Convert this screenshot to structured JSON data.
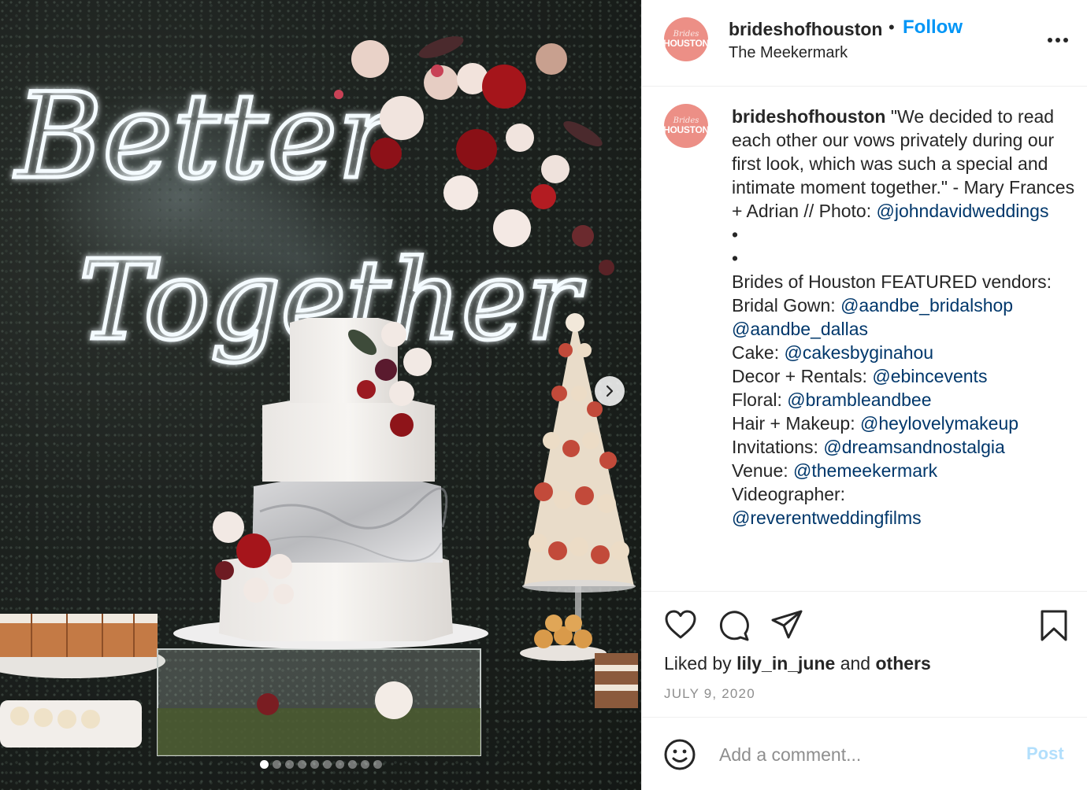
{
  "post": {
    "header": {
      "username": "brideshofhouston",
      "separator": "•",
      "follow_label": "Follow",
      "location": "The Meekermark",
      "more_icon": "more-horizontal-icon"
    },
    "avatar": {
      "script_text": "Brides",
      "word_text": "HOUSTON",
      "color": "#ec8f86"
    },
    "caption": {
      "username": "brideshofhouston",
      "intro": "\"We decided to read each other our vows privately during our first look, which was such a special and intimate moment together.\" - Mary Frances + Adrian // Photo:",
      "photo_credit": "@johndavidweddings",
      "bullet_1": "•",
      "bullet_2": "•",
      "featured_heading": "Brides of Houston FEATURED vendors:",
      "vendors": [
        {
          "label": "Bridal Gown:",
          "handle": "@aandbe_bridalshop"
        },
        {
          "label": "",
          "handle": "@aandbe_dallas"
        },
        {
          "label": "Cake:",
          "handle": "@cakesbyginahou"
        },
        {
          "label": "Decor + Rentals:",
          "handle": "@ebincevents"
        },
        {
          "label": "Floral:",
          "handle": "@brambleandbee"
        },
        {
          "label": "Hair + Makeup:",
          "handle": "@heylovelymakeup"
        },
        {
          "label": "Invitations:",
          "handle": "@dreamsandnostalgia"
        },
        {
          "label": "Venue:",
          "handle": "@themeekermark"
        },
        {
          "label": "Videographer:",
          "handle": ""
        },
        {
          "label": "",
          "handle": "@reverentweddingfilms"
        }
      ]
    },
    "actions": {
      "like_icon": "heart-icon",
      "comment_icon": "comment-icon",
      "share_icon": "share-icon",
      "save_icon": "bookmark-icon"
    },
    "likes": {
      "prefix": "Liked by",
      "user": "lily_in_june",
      "connector": "and",
      "others": "others"
    },
    "date": "JULY 9, 2020",
    "comment": {
      "placeholder": "Add a comment...",
      "post_label": "Post",
      "emoji_icon": "emoji-icon"
    },
    "media": {
      "neon_line_1": "Better",
      "neon_line_2": "Together",
      "next_icon": "chevron-right-icon",
      "slide_count": 10,
      "active_slide": 1
    },
    "colors": {
      "link": "#00376b",
      "follow": "#0095f6",
      "muted": "#8e8e8e",
      "post_disabled": "#b2dffc"
    }
  }
}
